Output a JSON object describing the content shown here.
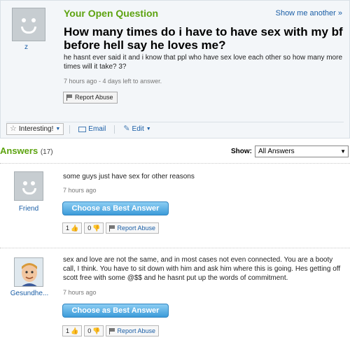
{
  "question": {
    "label": "Your Open Question",
    "show_more": "Show me another »",
    "asker": "z",
    "title": "How many times do i have to have sex with my bf before hell say he loves me?",
    "body": "he hasnt ever said it and i know that ppl who have sex love each other so how many more times will it take? 3?",
    "meta": "7 hours ago - 4 days left to answer.",
    "report": "Report Abuse",
    "toolbar": {
      "interesting": "Interesting!",
      "email": "Email",
      "edit": "Edit"
    }
  },
  "answers_header": {
    "label": "Answers",
    "count": "(17)",
    "show_label": "Show:",
    "show_value": "All Answers"
  },
  "answers": [
    {
      "author": "Friend",
      "text": "some guys just have sex for other reasons",
      "time": "7 hours ago",
      "best_button": "Choose as Best Answer",
      "up": "1",
      "down": "0",
      "report": "Report Abuse"
    },
    {
      "author": "Gesundhe...",
      "text": "sex and love are not the same, and in most cases not even connected. You are a booty call, I think. You have to sit down with him and ask him where this is going. Hes getting off scott free with some @$$ and he hasnt put up the words of commitment.",
      "time": "7 hours ago",
      "best_button": "Choose as Best Answer",
      "up": "1",
      "down": "0",
      "report": "Report Abuse"
    }
  ],
  "colors": {
    "green": "#5da310",
    "link": "#1a5ea6",
    "button_blue": "#3c9bd9"
  }
}
